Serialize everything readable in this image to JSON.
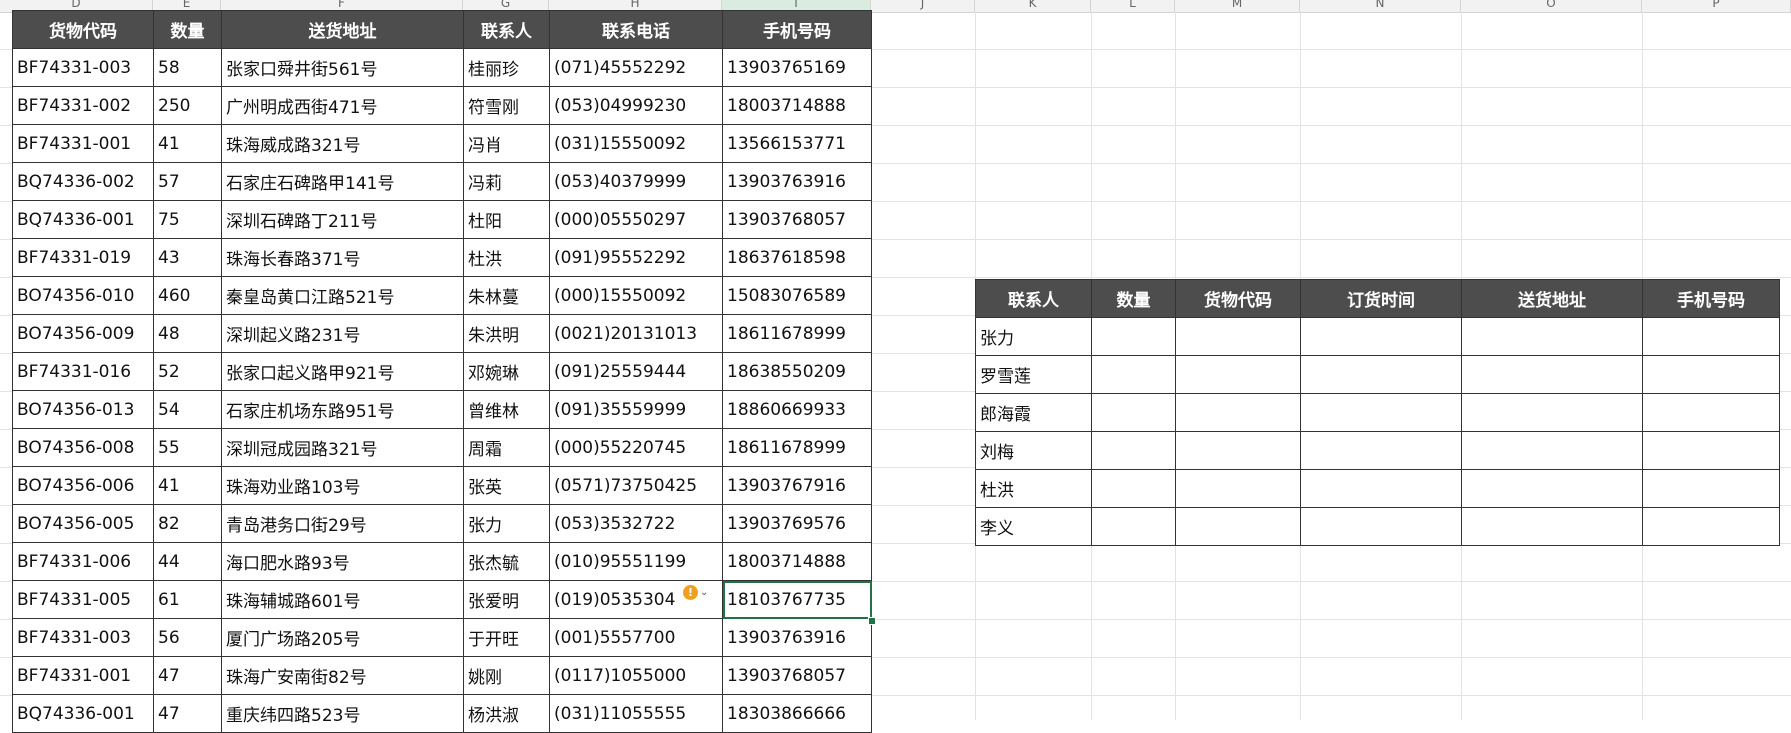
{
  "column_headers": [
    "D",
    "E",
    "F",
    "G",
    "H",
    "I",
    "J",
    "K",
    "L",
    "M",
    "N",
    "O",
    "P"
  ],
  "main_table": {
    "headers": [
      "货物代码",
      "数量",
      "送货地址",
      "联系人",
      "联系电话",
      "手机号码"
    ],
    "rows": [
      [
        "BF74331-003",
        "58",
        "张家口舜井街561号",
        "桂丽珍",
        "(071)45552292",
        "13903765169"
      ],
      [
        "BF74331-002",
        "250",
        "广州明成西街471号",
        "符雪刚",
        "(053)04999230",
        "18003714888"
      ],
      [
        "BF74331-001",
        "41",
        "珠海威成路321号",
        "冯肖",
        "(031)15550092",
        "13566153771"
      ],
      [
        "BQ74336-002",
        "57",
        "石家庄石碑路甲141号",
        "冯莉",
        "(053)40379999",
        "13903763916"
      ],
      [
        "BQ74336-001",
        "75",
        "深圳石碑路丁211号",
        "杜阳",
        "(000)05550297",
        "13903768057"
      ],
      [
        "BF74331-019",
        "43",
        "珠海长春路371号",
        "杜洪",
        "(091)95552292",
        "18637618598"
      ],
      [
        "BO74356-010",
        "460",
        "秦皇岛黄口江路521号",
        "朱林蔓",
        "(000)15550092",
        "15083076589"
      ],
      [
        "BO74356-009",
        "48",
        "深圳起义路231号",
        "朱洪明",
        "(0021)20131013",
        "18611678999"
      ],
      [
        "BF74331-016",
        "52",
        "张家口起义路甲921号",
        "邓婉琳",
        "(091)25559444",
        "18638550209"
      ],
      [
        "BO74356-013",
        "54",
        "石家庄机场东路951号",
        "曾维林",
        "(091)35559999",
        "18860669933"
      ],
      [
        "BO74356-008",
        "55",
        "深圳冠成园路321号",
        "周霜",
        "(000)55220745",
        "18611678999"
      ],
      [
        "BO74356-006",
        "41",
        "珠海劝业路103号",
        "张英",
        "(0571)73750425",
        "13903767916"
      ],
      [
        "BO74356-005",
        "82",
        "青岛港务口街29号",
        "张力",
        "(053)3532722",
        "13903769576"
      ],
      [
        "BF74331-006",
        "44",
        "海口肥水路93号",
        "张杰毓",
        "(010)95551199",
        "18003714888"
      ],
      [
        "BF74331-005",
        "61",
        "珠海辅城路601号",
        "张爱明",
        "(019)0535304",
        "18103767735"
      ],
      [
        "BF74331-003",
        "56",
        "厦门广场路205号",
        "于开旺",
        "(001)5557700",
        "13903763916"
      ],
      [
        "BF74331-001",
        "47",
        "珠海广安南街82号",
        "姚刚",
        "(0117)1055000",
        "13903768057"
      ],
      [
        "BQ74336-001",
        "47",
        "重庆纬四路523号",
        "杨洪淑",
        "(031)11055555",
        "18303866666"
      ]
    ]
  },
  "lookup_table": {
    "headers": [
      "联系人",
      "数量",
      "货物代码",
      "订货时间",
      "送货地址",
      "手机号码"
    ],
    "rows": [
      [
        "张力",
        "",
        "",
        "",
        "",
        ""
      ],
      [
        "罗雪莲",
        "",
        "",
        "",
        "",
        ""
      ],
      [
        "郎海霞",
        "",
        "",
        "",
        "",
        ""
      ],
      [
        "刘梅",
        "",
        "",
        "",
        "",
        ""
      ],
      [
        "杜洪",
        "",
        "",
        "",
        "",
        ""
      ],
      [
        "李义",
        "",
        "",
        "",
        "",
        ""
      ]
    ]
  },
  "selected_cell": {
    "row": 14,
    "col": 5
  },
  "warning_icon": "exclamation-circle-icon",
  "colors": {
    "header_bg": "#4d4d4d",
    "header_text": "#ffffff",
    "selection": "#217346",
    "warning": "#f0a020"
  }
}
